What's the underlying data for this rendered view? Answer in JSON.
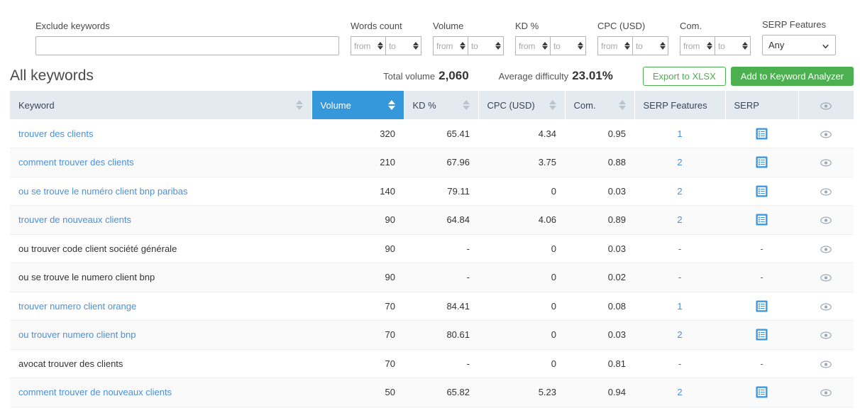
{
  "filters": {
    "exclude_keywords": {
      "label": "Exclude keywords",
      "value": "",
      "placeholder": ""
    },
    "ranges": [
      {
        "label": "Words count",
        "from_placeholder": "from",
        "to_placeholder": "to",
        "from_value": "",
        "to_value": ""
      },
      {
        "label": "Volume",
        "from_placeholder": "from",
        "to_placeholder": "to",
        "from_value": "",
        "to_value": ""
      },
      {
        "label": "KD %",
        "from_placeholder": "from",
        "to_placeholder": "to",
        "from_value": "",
        "to_value": ""
      },
      {
        "label": "CPC (USD)",
        "from_placeholder": "from",
        "to_placeholder": "to",
        "from_value": "",
        "to_value": ""
      },
      {
        "label": "Com.",
        "from_placeholder": "from",
        "to_placeholder": "to",
        "from_value": "",
        "to_value": ""
      }
    ],
    "serp_features": {
      "label": "SERP Features",
      "selected": "Any"
    },
    "clear_icon": "close-x-icon",
    "accent_orange": "#f08a24"
  },
  "summary": {
    "title": "All keywords",
    "total_volume_label": "Total volume",
    "total_volume_value": "2,060",
    "avg_difficulty_label": "Average difficulty",
    "avg_difficulty_value": "23.01%",
    "export_button": "Export to XLSX",
    "add_button": "Add to Keyword Analyzer",
    "green": "#4caf50"
  },
  "table": {
    "sorted_column": "Volume",
    "sorted_color": "#3498db",
    "columns": [
      {
        "label": "Keyword",
        "sortable": true,
        "sorted": false
      },
      {
        "label": "Volume",
        "sortable": true,
        "sorted": true
      },
      {
        "label": "KD %",
        "sortable": true,
        "sorted": false
      },
      {
        "label": "CPC (USD)",
        "sortable": true,
        "sorted": false
      },
      {
        "label": "Com.",
        "sortable": true,
        "sorted": false
      },
      {
        "label": "SERP Features",
        "sortable": false,
        "sorted": false
      },
      {
        "label": "SERP",
        "sortable": false,
        "sorted": false
      },
      {
        "label": "",
        "sortable": false,
        "sorted": false,
        "icon": "eye-icon"
      }
    ],
    "rows": [
      {
        "keyword": "trouver des clients",
        "is_link": true,
        "volume": "320",
        "kd": "65.41",
        "cpc": "4.34",
        "com": "0.95",
        "serp_features": "1",
        "serp": "serp-list-icon"
      },
      {
        "keyword": "comment trouver des clients",
        "is_link": true,
        "volume": "210",
        "kd": "67.96",
        "cpc": "3.75",
        "com": "0.88",
        "serp_features": "2",
        "serp": "serp-list-icon"
      },
      {
        "keyword": "ou se trouve le numéro client bnp paribas",
        "is_link": true,
        "volume": "140",
        "kd": "79.11",
        "cpc": "0",
        "com": "0.03",
        "serp_features": "2",
        "serp": "serp-list-icon"
      },
      {
        "keyword": "trouver de nouveaux clients",
        "is_link": true,
        "volume": "90",
        "kd": "64.84",
        "cpc": "4.06",
        "com": "0.89",
        "serp_features": "2",
        "serp": "serp-list-icon"
      },
      {
        "keyword": "ou trouver code client société générale",
        "is_link": false,
        "volume": "90",
        "kd": "-",
        "cpc": "0",
        "com": "0.03",
        "serp_features": "-",
        "serp": "-"
      },
      {
        "keyword": "ou se trouve le numero client bnp",
        "is_link": false,
        "volume": "90",
        "kd": "-",
        "cpc": "0",
        "com": "0.02",
        "serp_features": "-",
        "serp": "-"
      },
      {
        "keyword": "trouver numero client orange",
        "is_link": true,
        "volume": "70",
        "kd": "84.41",
        "cpc": "0",
        "com": "0.08",
        "serp_features": "1",
        "serp": "serp-list-icon"
      },
      {
        "keyword": "ou trouver numero client bnp",
        "is_link": true,
        "volume": "70",
        "kd": "80.61",
        "cpc": "0",
        "com": "0.03",
        "serp_features": "2",
        "serp": "serp-list-icon"
      },
      {
        "keyword": "avocat trouver des clients",
        "is_link": false,
        "volume": "70",
        "kd": "-",
        "cpc": "0",
        "com": "0.81",
        "serp_features": "-",
        "serp": "-"
      },
      {
        "keyword": "comment trouver de nouveaux clients",
        "is_link": true,
        "volume": "50",
        "kd": "65.82",
        "cpc": "5.23",
        "com": "0.94",
        "serp_features": "2",
        "serp": "serp-list-icon"
      }
    ]
  }
}
